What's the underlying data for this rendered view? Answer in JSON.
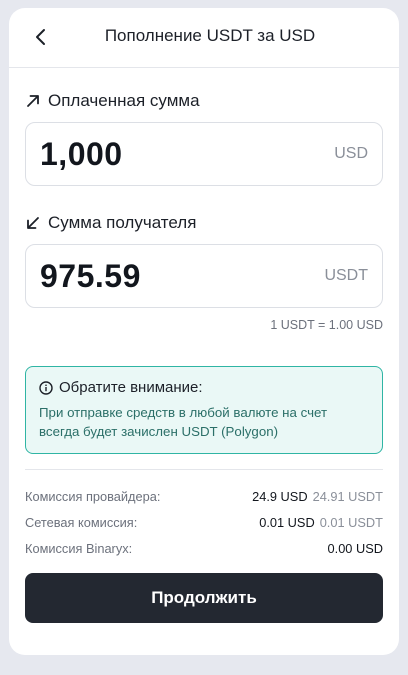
{
  "header": {
    "title": "Пополнение USDT за USD"
  },
  "paid": {
    "label": "Оплаченная сумма",
    "amount": "1,000",
    "currency": "USD"
  },
  "received": {
    "label": "Сумма получателя",
    "amount": "975.59",
    "currency": "USDT",
    "rate": "1 USDT = 1.00 USD"
  },
  "notice": {
    "title": "Обратите внимание:",
    "text": "При отправке средств в любой валюте на счет всегда будет зачислен USDT (Polygon)"
  },
  "fees": [
    {
      "label": "Комиссия провайдера:",
      "main": "24.9 USD",
      "alt": "24.91 USDT"
    },
    {
      "label": "Сетевая комиссия:",
      "main": "0.01 USD",
      "alt": "0.01 USDT"
    },
    {
      "label": "Комиссия Binaryx:",
      "main": "0.00 USD",
      "alt": ""
    }
  ],
  "actions": {
    "continue_label": "Продолжить"
  },
  "colors": {
    "accent": "#2fb5a4",
    "button": "#232831",
    "background": "#e6e8ef"
  },
  "icons": {
    "back": "chevron-left-icon",
    "paid": "arrow-up-right-icon",
    "received": "arrow-down-left-icon",
    "notice": "info-icon"
  }
}
